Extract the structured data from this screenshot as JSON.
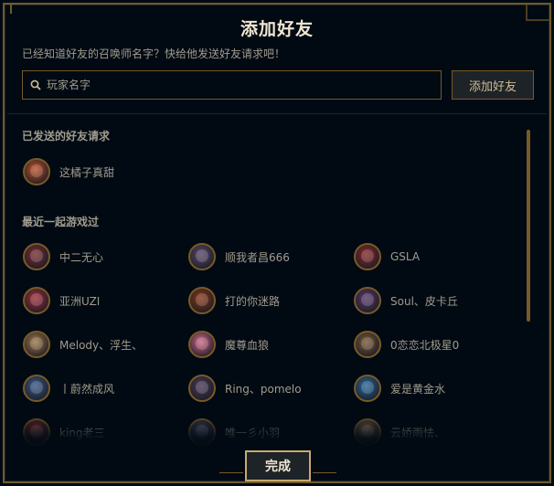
{
  "dialog": {
    "title": "添加好友",
    "subtitle": "已经知道好友的召唤师名字？快给他发送好友请求吧！"
  },
  "search": {
    "placeholder": "玩家名字",
    "value": "",
    "add_button_label": "添加好友"
  },
  "sent_requests": {
    "title": "已发送的好友请求",
    "items": [
      {
        "name": "这橘子真甜",
        "color": "#c0532a"
      }
    ]
  },
  "recent_players": {
    "title": "最近一起游戏过",
    "items": [
      {
        "name": "中二无心",
        "color": "#7a2f33"
      },
      {
        "name": "顺我者昌666",
        "color": "#5a4a6a"
      },
      {
        "name": "GSLA",
        "color": "#8a2a2a"
      },
      {
        "name": "亚洲UZI",
        "color": "#a02f3a"
      },
      {
        "name": "打的你迷路",
        "color": "#8a3a1a"
      },
      {
        "name": "Soul、皮卡丘",
        "color": "#5a3a6a"
      },
      {
        "name": "Melody、浮生、",
        "color": "#a07a4a"
      },
      {
        "name": "魔尊血狼",
        "color": "#d06a8a"
      },
      {
        "name": "0恋恋北极星0",
        "color": "#7a5a3a"
      },
      {
        "name": "丨蔚然成风",
        "color": "#3a5a8a"
      },
      {
        "name": "Ring、pomelo",
        "color": "#4a3a5a"
      },
      {
        "name": "爱是黄金水",
        "color": "#2a6a9a"
      },
      {
        "name": "king老三",
        "color": "#8a2a2a"
      },
      {
        "name": "唯一彡小羽",
        "color": "#4a4a6a"
      },
      {
        "name": "云娇雨怯、",
        "color": "#8a6a4a"
      }
    ]
  },
  "footer": {
    "done_label": "完成"
  },
  "colors": {
    "accent_gold": "#c8aa6e",
    "border_gold": "#785a28",
    "background": "#010a13",
    "text_muted": "#a09b8c"
  }
}
